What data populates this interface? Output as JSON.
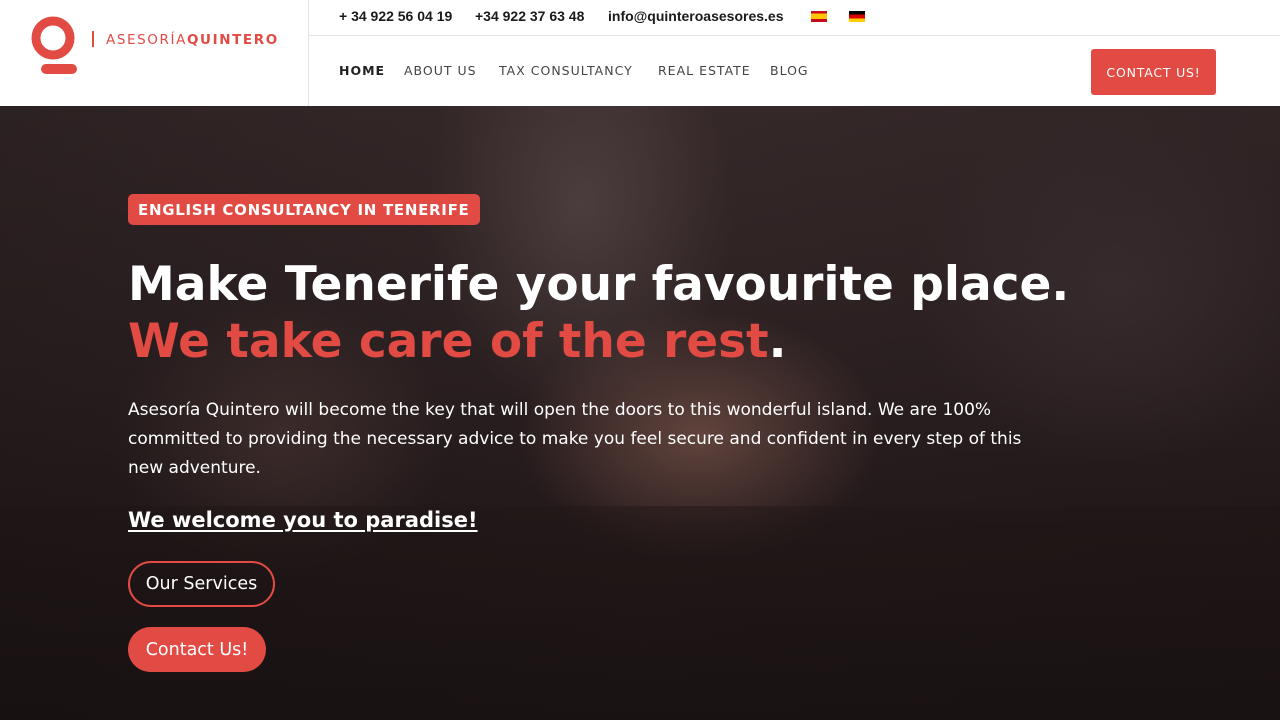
{
  "brand": {
    "name_light": "ASESORÍA",
    "name_bold": "QUINTERO",
    "color": "#e24b43",
    "logo_icon": "q-logo-icon"
  },
  "topbar": {
    "phone1": "+ 34 922 56 04 19",
    "phone2": "+34 922 37 63 48",
    "email": "info@quinteroasesores.es",
    "flags": [
      "spanish-flag-icon",
      "german-flag-icon"
    ]
  },
  "nav": {
    "items": [
      "HOME",
      "ABOUT US",
      "TAX CONSULTANCY",
      "REAL ESTATE",
      "BLOG"
    ],
    "active": "HOME",
    "cta": "CONTACT US!"
  },
  "hero": {
    "badge": "ENGLISH CONSULTANCY IN TENERIFE",
    "title_line1": "Make Tenerife your favourite place.",
    "title_line2_red": "We take care of the rest",
    "title_line2_end": ".",
    "lead": "Asesoría Quintero will become the key that will open the doors to this wonderful island. We are 100% committed to providing the necessary advice to make you feel secure and confident in every step of this new adventure.",
    "welcome": "We welcome you to paradise!",
    "btn_services": "Our Services",
    "btn_contact": "Contact Us!"
  },
  "colors": {
    "accent": "#e24b43",
    "header_bg": "#ffffff",
    "hero_text": "#ffffff"
  }
}
